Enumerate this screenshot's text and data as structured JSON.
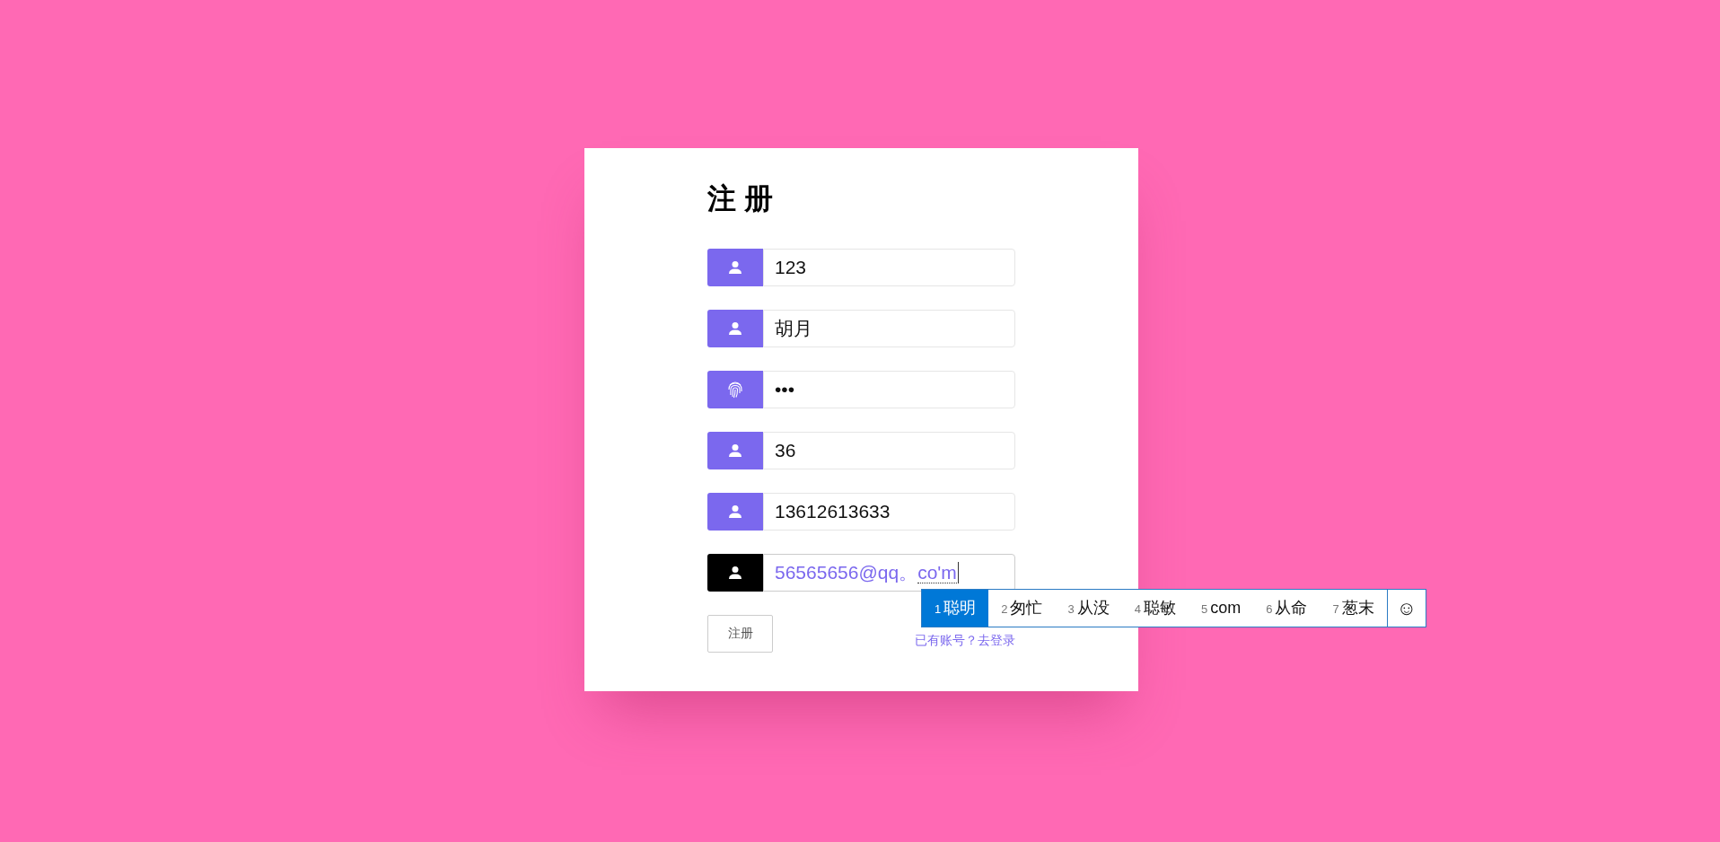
{
  "title": "注 册",
  "fields": [
    {
      "kind": "user",
      "value": "123",
      "focused": false
    },
    {
      "kind": "user",
      "value": "胡月",
      "focused": false
    },
    {
      "kind": "fingerprint",
      "value": "•••",
      "focused": false
    },
    {
      "kind": "user",
      "value": "36",
      "focused": false
    },
    {
      "kind": "user",
      "value": "13612613633",
      "focused": false
    },
    {
      "kind": "user",
      "value": "56565656@qq。",
      "composition": "co'm",
      "focused": true
    }
  ],
  "submit_button": "注册",
  "login_link": "已有账号？去登录",
  "ime": {
    "candidates": [
      {
        "number": "1",
        "text": "聪明",
        "selected": true
      },
      {
        "number": "2",
        "text": "匆忙",
        "selected": false
      },
      {
        "number": "3",
        "text": "从没",
        "selected": false
      },
      {
        "number": "4",
        "text": "聪敏",
        "selected": false
      },
      {
        "number": "5",
        "text": "com",
        "selected": false
      },
      {
        "number": "6",
        "text": "从命",
        "selected": false
      },
      {
        "number": "7",
        "text": "葱末",
        "selected": false
      }
    ],
    "emoji": "☺"
  }
}
